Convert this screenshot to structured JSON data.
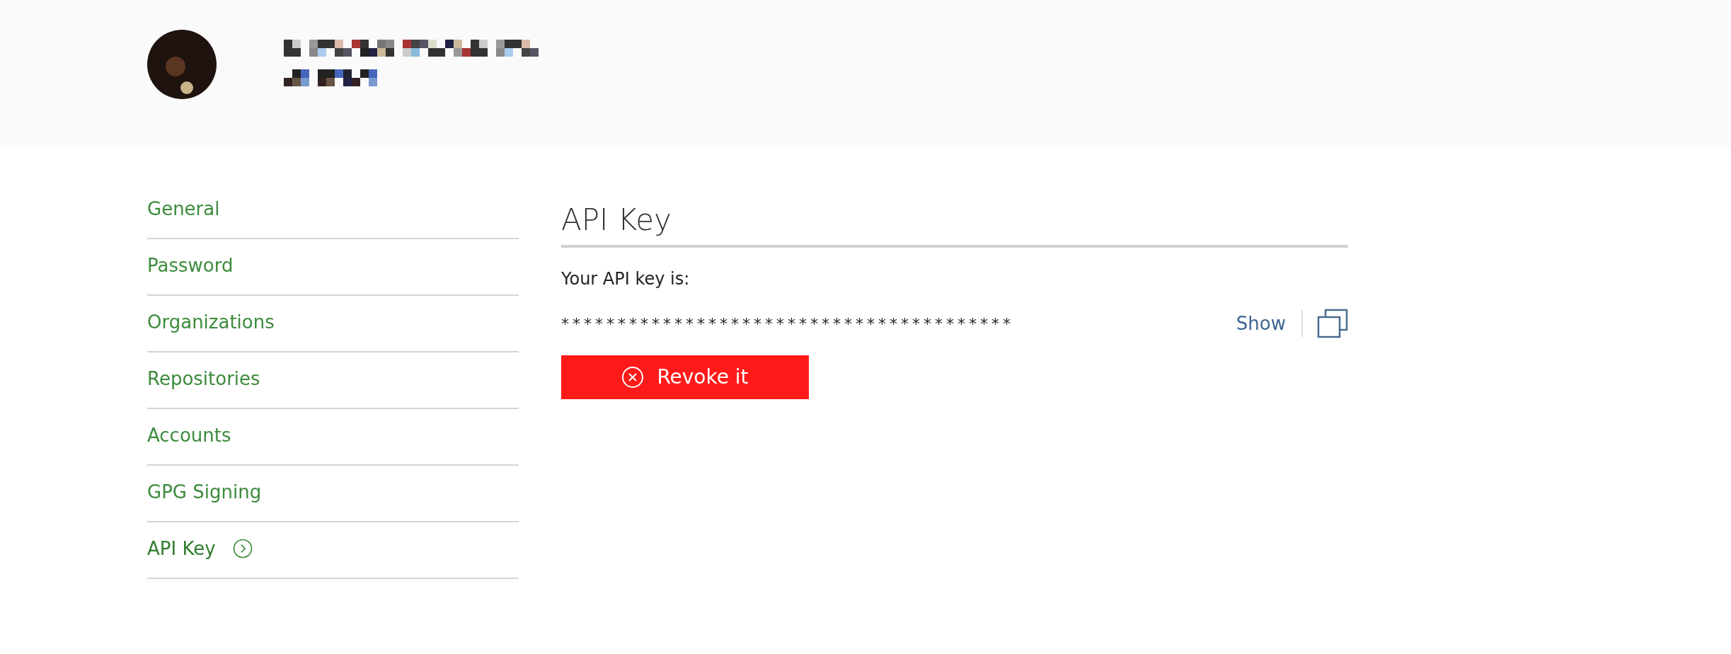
{
  "sidebar": {
    "items": [
      {
        "label": "General",
        "selected": false
      },
      {
        "label": "Password",
        "selected": false
      },
      {
        "label": "Organizations",
        "selected": false
      },
      {
        "label": "Repositories",
        "selected": false
      },
      {
        "label": "Accounts",
        "selected": false
      },
      {
        "label": "GPG Signing",
        "selected": false
      },
      {
        "label": "API Key",
        "selected": true
      }
    ]
  },
  "main": {
    "title": "API Key",
    "intro": "Your API key is:",
    "masked_key": "****************************************",
    "show_link": "Show",
    "revoke_button": "Revoke it"
  }
}
